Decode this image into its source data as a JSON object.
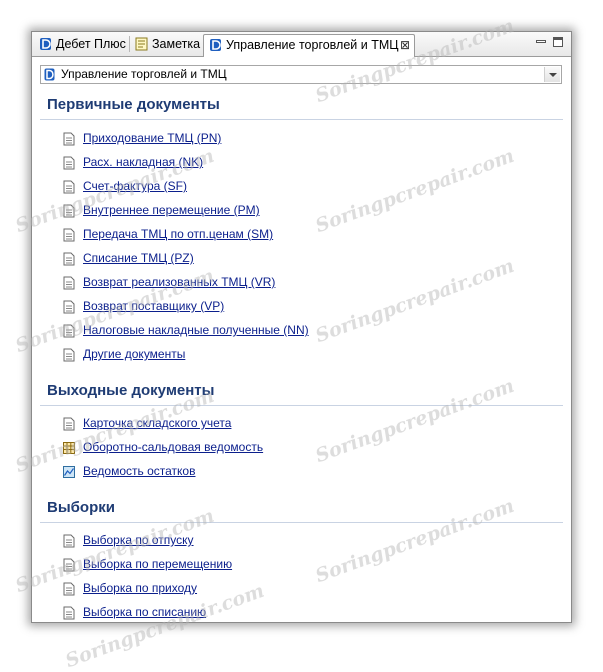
{
  "tabs": [
    {
      "label": "Дебет Плюс",
      "icon": "debet-app-icon"
    },
    {
      "label": "Заметка",
      "icon": "note-icon"
    },
    {
      "label": "Управление торговлей и ТМЦ",
      "icon": "debet-app-icon",
      "active": true,
      "close_symbol": "⊠"
    }
  ],
  "selector": {
    "value": "Управление торговлей и ТМЦ"
  },
  "sections": [
    {
      "title": "Первичные документы",
      "items": [
        "Приходование ТМЦ (PN)",
        "Расх. накладная (NK)",
        "Счет-фактура (SF)",
        "Внутреннее перемещение (PM)",
        "Передача ТМЦ по отп.ценам (SM)",
        "Списание ТМЦ (PZ)",
        "Возврат реализованных ТМЦ (VR)",
        "Возврат поставщику (VP)",
        "Налоговые накладные полученные (NN)",
        "Другие документы"
      ]
    },
    {
      "title": "Выходные документы",
      "items": [
        "Карточка складского учета",
        "Оборотно-сальдовая ведомость",
        "Ведомость остатков"
      ]
    },
    {
      "title": "Выборки",
      "items": [
        "Выборка по отпуску",
        "Выборка по перемещению",
        "Выборка по приходу",
        "Выборка по списанию"
      ]
    }
  ],
  "watermark": "Soringpcrepair.com",
  "colors": {
    "section_title": "#1f3c74",
    "link": "#0b1f8c",
    "section_line": "#c9d3e3"
  }
}
